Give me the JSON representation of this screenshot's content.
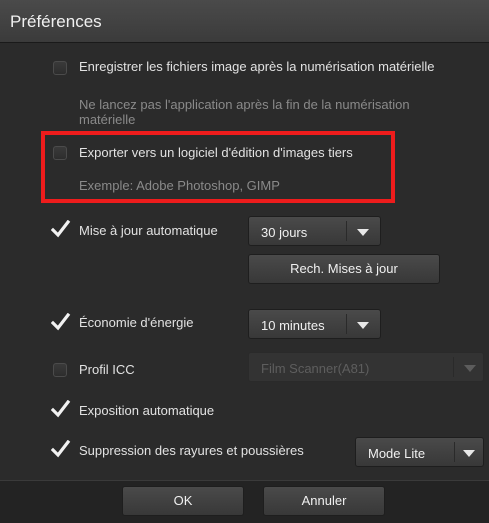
{
  "window": {
    "title": "Préférences"
  },
  "options": {
    "save_images": {
      "label": "Enregistrer les fichiers image après la numérisation matérielle",
      "checked": false,
      "description": "Ne lancez pas l'application après la fin de la numérisation matérielle"
    },
    "export_editor": {
      "label": "Exporter vers un logiciel d'édition d'images tiers",
      "checked": false,
      "description": "Exemple: Adobe Photoshop, GIMP"
    },
    "auto_update": {
      "label": "Mise à jour automatique",
      "checked": true,
      "interval": "30 jours",
      "check_button": "Rech. Mises à jour"
    },
    "power_saving": {
      "label": "Économie d'énergie",
      "checked": true,
      "delay": "10 minutes"
    },
    "icc_profile": {
      "label": "Profil ICC",
      "checked": false,
      "profile": "Film Scanner(A81)"
    },
    "auto_exposure": {
      "label": "Exposition automatique",
      "checked": true
    },
    "dust_removal": {
      "label": "Suppression des rayures et poussières",
      "checked": true,
      "mode": "Mode Lite"
    }
  },
  "buttons": {
    "ok": "OK",
    "cancel": "Annuler"
  },
  "colors": {
    "highlight": "#ee1c1c",
    "background": "#2b2b2b",
    "checkmark": "#f2f2f2"
  }
}
